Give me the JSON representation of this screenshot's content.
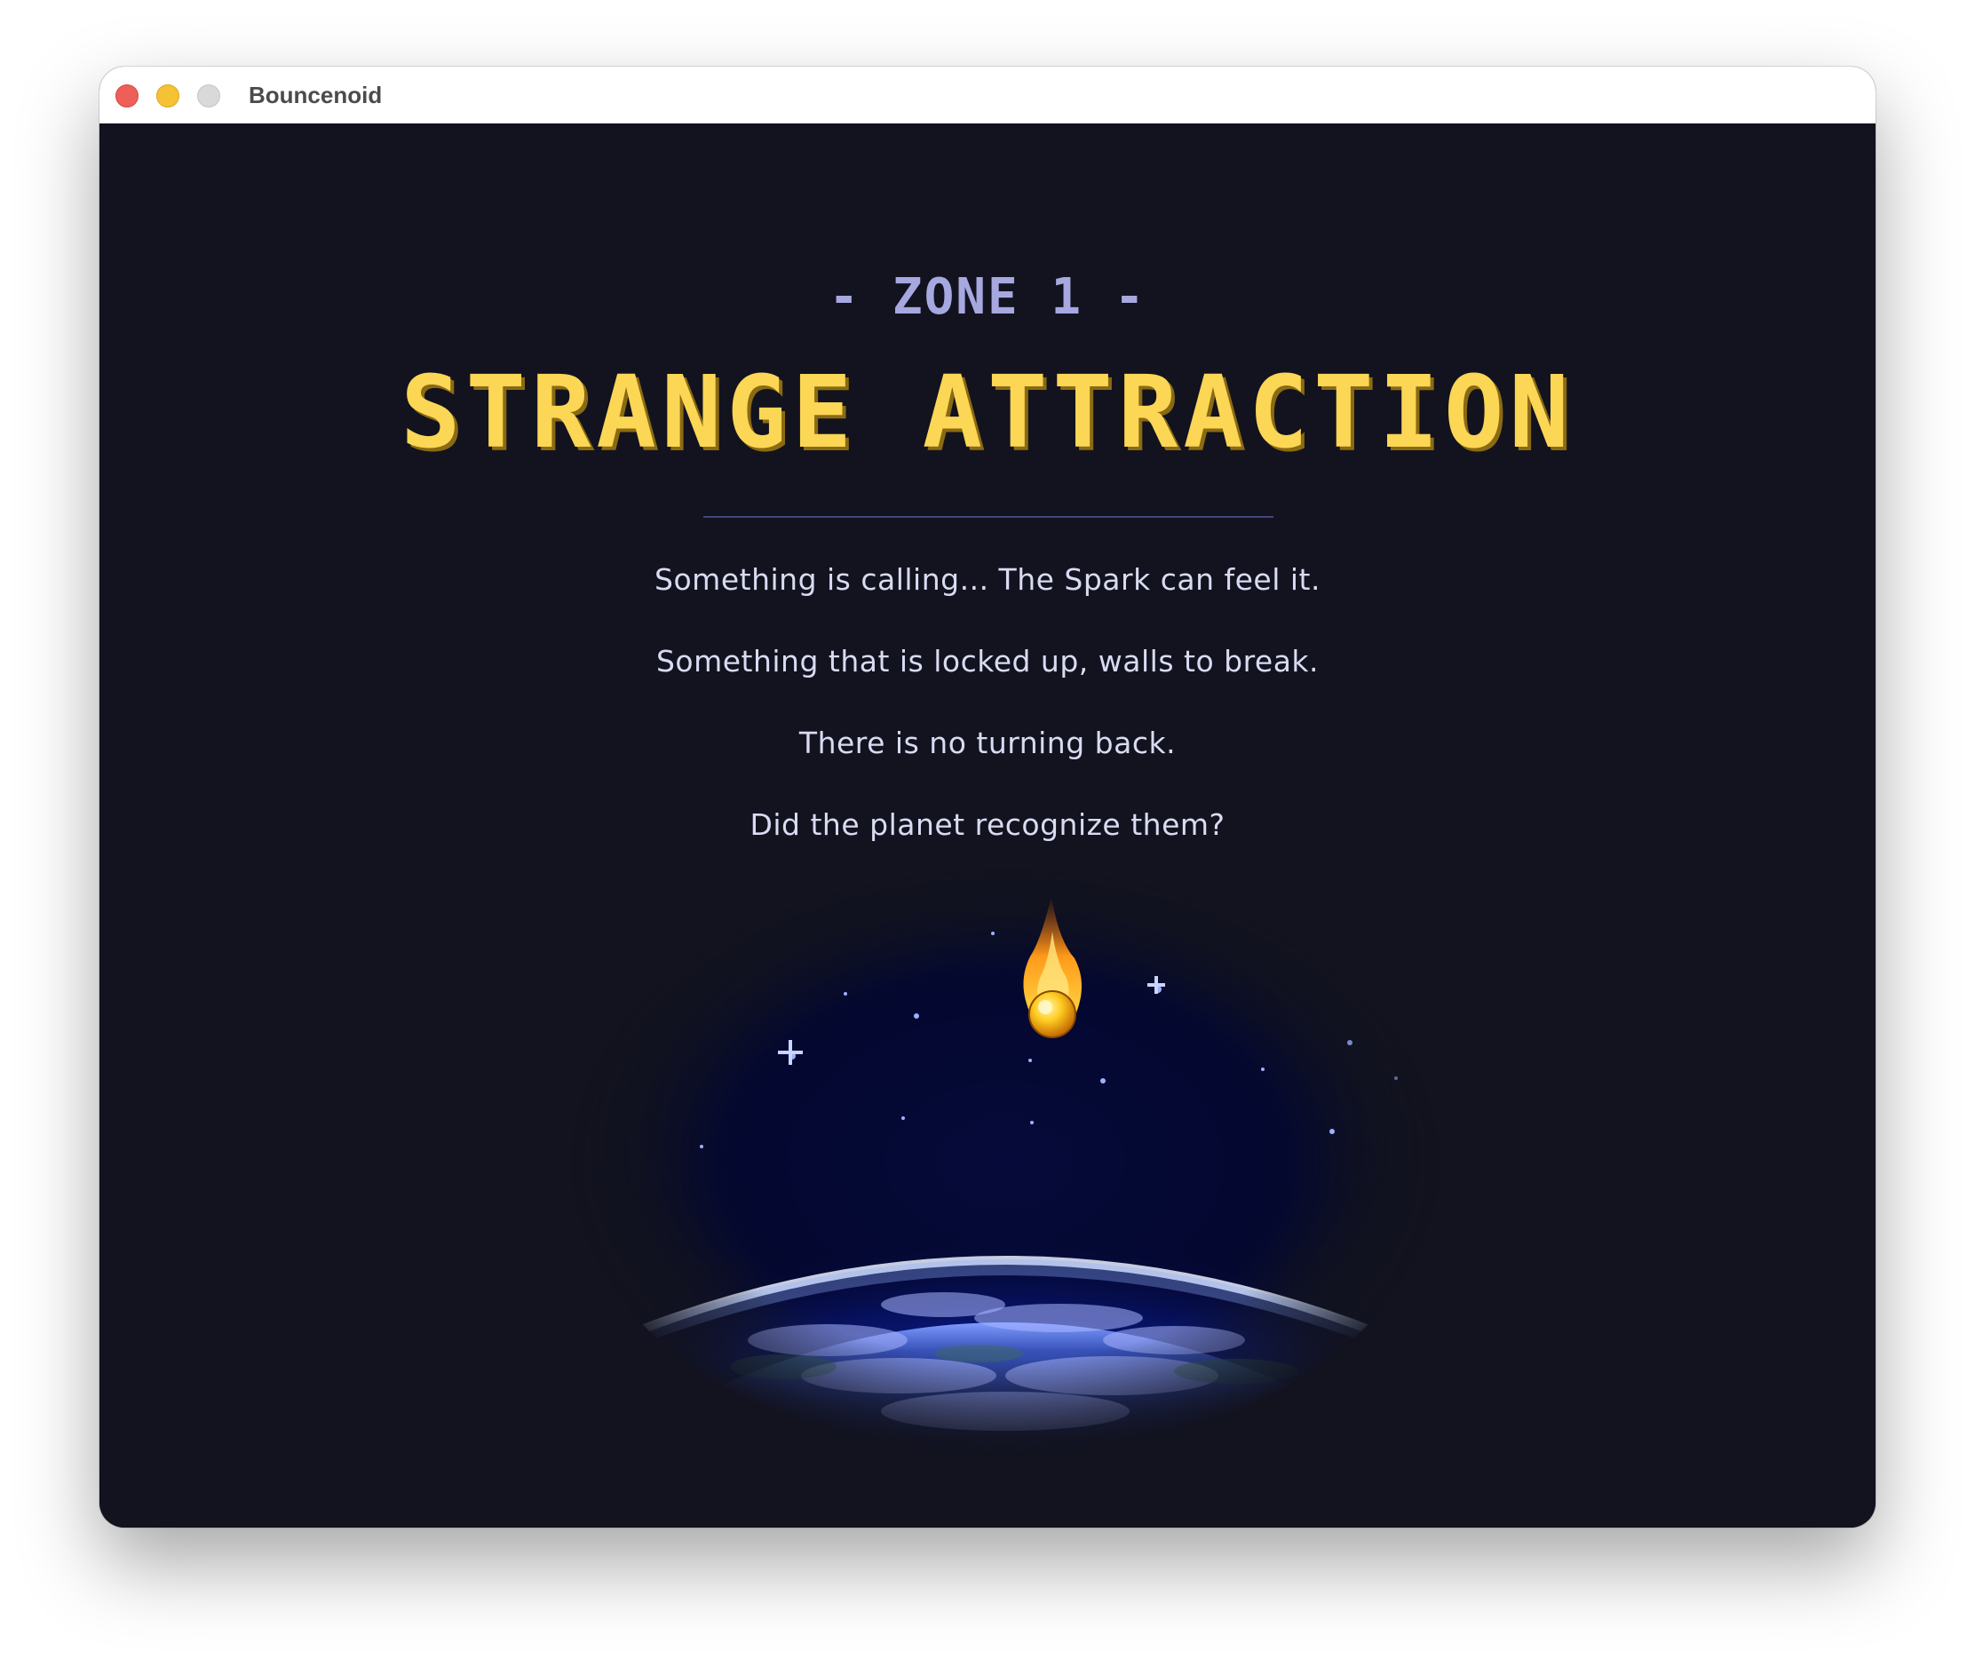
{
  "window": {
    "title": "Bouncenoid",
    "controls": [
      "close",
      "minimize",
      "maximize"
    ]
  },
  "intro": {
    "zone_label": "- ZONE 1 -",
    "title": "STRANGE ATTRACTION",
    "story_lines": [
      "Something is calling... The Spark can feel it.",
      "Something that is locked up, walls to break.",
      "There is no turning back.",
      "Did the planet recognize them?"
    ]
  },
  "scene": {
    "planet_icon": "planet-earth-icon",
    "spark_icon": "fireball-icon"
  },
  "colors": {
    "background": "#12131f",
    "title": "#fcd655",
    "zone": "#a7a8e0",
    "text": "#d9dbf2",
    "divider": "#42477c"
  }
}
